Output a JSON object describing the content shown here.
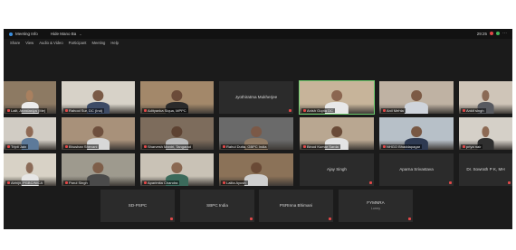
{
  "window": {
    "title": "Meeting Info",
    "host_label": "Hide Mano Ba",
    "clock": "29:25"
  },
  "menu": [
    "Share",
    "View",
    "Audio & Video",
    "Participant",
    "Meeting",
    "Help"
  ],
  "colors": {
    "window_bg": "#1b1b1b",
    "tile_bg": "#2b2b2b",
    "muted_mic": "#e04848",
    "active_speaker": "#6fcf6f"
  },
  "tiles": [
    {
      "name": "Lalit, Anastasiya (Me)",
      "kind": "video",
      "wall": "#8d7a63",
      "skin": "#a9805f",
      "shirt": "#ececec"
    },
    {
      "name": "Rahool Sur, DC (Ind)",
      "kind": "video",
      "wall": "#d7d2c8",
      "skin": "#7a5a46",
      "shirt": "#3d4b66"
    },
    {
      "name": "Adityanka Siqua, MPPC",
      "kind": "video",
      "wall": "#a3886a",
      "skin": "#6b4b39",
      "shirt": "#2a2a2a"
    },
    {
      "name": "Jyothiratma Mukherjee",
      "kind": "name"
    },
    {
      "name": "Anish Gupta DC",
      "kind": "video",
      "wall": "#c7b49a",
      "skin": "#8b6650",
      "shirt": "#e8e8e8"
    },
    {
      "name": "Anil Mehta",
      "kind": "video",
      "wall": "#bfb2a3",
      "skin": "#7c5a45",
      "shirt": "#cfd4dc"
    },
    {
      "name": "Ankit singh",
      "kind": "video",
      "wall": "#cfc5b8",
      "skin": "#8a6a55",
      "shirt": "#585a60"
    },
    {
      "name": "Tripti Jain",
      "kind": "video",
      "wall": "#d1ccc4",
      "skin": "#8f6a55",
      "shirt": "#5d7a9a"
    },
    {
      "name": "Bhushan Shevani",
      "kind": "video",
      "wall": "#a8917a",
      "skin": "#6e4f3d",
      "shirt": "#d8d8d8"
    },
    {
      "name": "Sharvesh Mantri, Tangarad",
      "kind": "video",
      "wall": "#7d6c5c",
      "skin": "#5d4232",
      "shirt": "#b9b9b9"
    },
    {
      "name": "Rahul Dutta, GBPC India",
      "kind": "video",
      "wall": "#6a6a6a",
      "skin": "#7b5947",
      "shirt": "#8f7a64"
    },
    {
      "name": "Binod Kumar Sarda",
      "kind": "video",
      "wall": "#b9a791",
      "skin": "#6a4b38",
      "shirt": "#e4e4e4"
    },
    {
      "name": "NHGO Bhaddapagar",
      "kind": "video",
      "wall": "#b7c0c8",
      "skin": "#785844",
      "shirt": "#2e3a52"
    },
    {
      "name": "priya nair",
      "kind": "video",
      "wall": "#d5d0c8",
      "skin": "#8d6a54",
      "shirt": "#2f2f2f"
    },
    {
      "name": "Abhijit, PGBC/NICA",
      "kind": "video",
      "wall": "#d8d2c6",
      "skin": "#8b6b58",
      "shirt": "#e6e6e6"
    },
    {
      "name": "Parul Singh",
      "kind": "video",
      "wall": "#9e9a8e",
      "skin": "#7e5e49",
      "shirt": "#4a4a4a"
    },
    {
      "name": "Aparimita Chandra",
      "kind": "video",
      "wall": "#c9c2b6",
      "skin": "#8a6852",
      "shirt": "#3b6a5b"
    },
    {
      "name": "Lalita Ayush",
      "kind": "video",
      "wall": "#8b7258",
      "skin": "#6a4a36",
      "shirt": "#cfcfcf"
    },
    {
      "name": "Ajay Singh",
      "kind": "name"
    },
    {
      "name": "Aparna Srivastava",
      "kind": "name"
    },
    {
      "name": "Dr. Sowrath P K, MH",
      "kind": "name"
    },
    {
      "name": "SD-PSPC",
      "kind": "name"
    },
    {
      "name": "SBPC India",
      "kind": "name"
    },
    {
      "name": "PSRInna Bhimani",
      "kind": "name"
    },
    {
      "name": "FYMNRA",
      "sub": "Lorrey",
      "kind": "name"
    }
  ]
}
